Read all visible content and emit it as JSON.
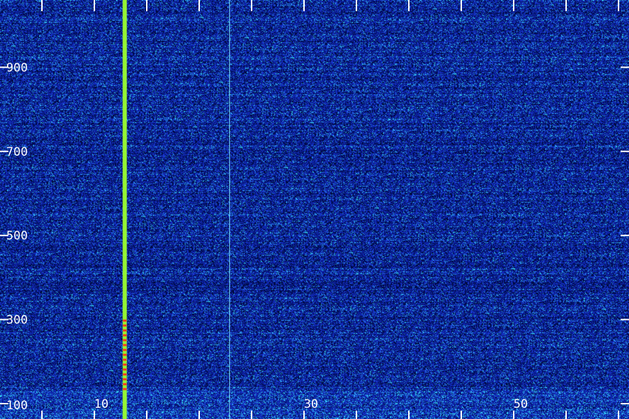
{
  "chart_data": {
    "type": "heatmap",
    "title": "",
    "xlabel": "",
    "ylabel": "",
    "xlim": [
      1,
      60
    ],
    "ylim": [
      100,
      1060
    ],
    "x_ticks": [
      {
        "value": 10,
        "label": "10"
      },
      {
        "value": 30,
        "label": "30"
      },
      {
        "value": 50,
        "label": "50"
      }
    ],
    "y_ticks": [
      {
        "value": 100,
        "label": "100"
      },
      {
        "value": 300,
        "label": "300"
      },
      {
        "value": 500,
        "label": "500"
      },
      {
        "value": 700,
        "label": "700"
      },
      {
        "value": 900,
        "label": "900"
      }
    ],
    "x_minor_step": 5,
    "signals": [
      {
        "x": 12.9,
        "y_range": [
          100,
          1060
        ],
        "color": "#9cff2e",
        "hot_y_range": [
          130,
          300
        ],
        "hot_color": "#ff3a1e"
      },
      {
        "x": 22.9,
        "y_range": [
          100,
          1060
        ],
        "color": "#7fe7ff"
      }
    ],
    "background_colors": [
      "#000a40",
      "#0a1f9e",
      "#1c3bd6",
      "#2fa5e8",
      "#37e0ff"
    ],
    "grid": false
  }
}
